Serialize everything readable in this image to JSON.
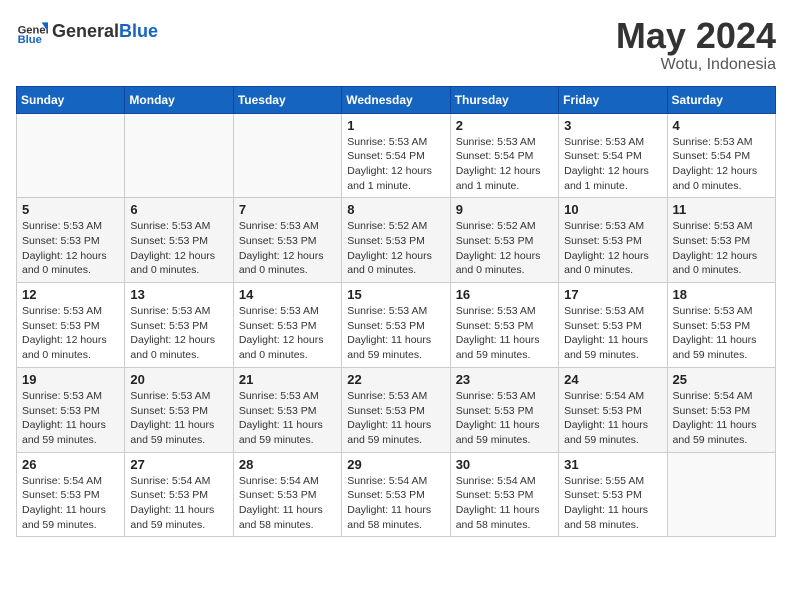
{
  "header": {
    "logo_general": "General",
    "logo_blue": "Blue",
    "month": "May 2024",
    "location": "Wotu, Indonesia"
  },
  "weekdays": [
    "Sunday",
    "Monday",
    "Tuesday",
    "Wednesday",
    "Thursday",
    "Friday",
    "Saturday"
  ],
  "weeks": [
    [
      {
        "day": "",
        "info": ""
      },
      {
        "day": "",
        "info": ""
      },
      {
        "day": "",
        "info": ""
      },
      {
        "day": "1",
        "info": "Sunrise: 5:53 AM\nSunset: 5:54 PM\nDaylight: 12 hours\nand 1 minute."
      },
      {
        "day": "2",
        "info": "Sunrise: 5:53 AM\nSunset: 5:54 PM\nDaylight: 12 hours\nand 1 minute."
      },
      {
        "day": "3",
        "info": "Sunrise: 5:53 AM\nSunset: 5:54 PM\nDaylight: 12 hours\nand 1 minute."
      },
      {
        "day": "4",
        "info": "Sunrise: 5:53 AM\nSunset: 5:54 PM\nDaylight: 12 hours\nand 0 minutes."
      }
    ],
    [
      {
        "day": "5",
        "info": "Sunrise: 5:53 AM\nSunset: 5:53 PM\nDaylight: 12 hours\nand 0 minutes."
      },
      {
        "day": "6",
        "info": "Sunrise: 5:53 AM\nSunset: 5:53 PM\nDaylight: 12 hours\nand 0 minutes."
      },
      {
        "day": "7",
        "info": "Sunrise: 5:53 AM\nSunset: 5:53 PM\nDaylight: 12 hours\nand 0 minutes."
      },
      {
        "day": "8",
        "info": "Sunrise: 5:52 AM\nSunset: 5:53 PM\nDaylight: 12 hours\nand 0 minutes."
      },
      {
        "day": "9",
        "info": "Sunrise: 5:52 AM\nSunset: 5:53 PM\nDaylight: 12 hours\nand 0 minutes."
      },
      {
        "day": "10",
        "info": "Sunrise: 5:53 AM\nSunset: 5:53 PM\nDaylight: 12 hours\nand 0 minutes."
      },
      {
        "day": "11",
        "info": "Sunrise: 5:53 AM\nSunset: 5:53 PM\nDaylight: 12 hours\nand 0 minutes."
      }
    ],
    [
      {
        "day": "12",
        "info": "Sunrise: 5:53 AM\nSunset: 5:53 PM\nDaylight: 12 hours\nand 0 minutes."
      },
      {
        "day": "13",
        "info": "Sunrise: 5:53 AM\nSunset: 5:53 PM\nDaylight: 12 hours\nand 0 minutes."
      },
      {
        "day": "14",
        "info": "Sunrise: 5:53 AM\nSunset: 5:53 PM\nDaylight: 12 hours\nand 0 minutes."
      },
      {
        "day": "15",
        "info": "Sunrise: 5:53 AM\nSunset: 5:53 PM\nDaylight: 11 hours\nand 59 minutes."
      },
      {
        "day": "16",
        "info": "Sunrise: 5:53 AM\nSunset: 5:53 PM\nDaylight: 11 hours\nand 59 minutes."
      },
      {
        "day": "17",
        "info": "Sunrise: 5:53 AM\nSunset: 5:53 PM\nDaylight: 11 hours\nand 59 minutes."
      },
      {
        "day": "18",
        "info": "Sunrise: 5:53 AM\nSunset: 5:53 PM\nDaylight: 11 hours\nand 59 minutes."
      }
    ],
    [
      {
        "day": "19",
        "info": "Sunrise: 5:53 AM\nSunset: 5:53 PM\nDaylight: 11 hours\nand 59 minutes."
      },
      {
        "day": "20",
        "info": "Sunrise: 5:53 AM\nSunset: 5:53 PM\nDaylight: 11 hours\nand 59 minutes."
      },
      {
        "day": "21",
        "info": "Sunrise: 5:53 AM\nSunset: 5:53 PM\nDaylight: 11 hours\nand 59 minutes."
      },
      {
        "day": "22",
        "info": "Sunrise: 5:53 AM\nSunset: 5:53 PM\nDaylight: 11 hours\nand 59 minutes."
      },
      {
        "day": "23",
        "info": "Sunrise: 5:53 AM\nSunset: 5:53 PM\nDaylight: 11 hours\nand 59 minutes."
      },
      {
        "day": "24",
        "info": "Sunrise: 5:54 AM\nSunset: 5:53 PM\nDaylight: 11 hours\nand 59 minutes."
      },
      {
        "day": "25",
        "info": "Sunrise: 5:54 AM\nSunset: 5:53 PM\nDaylight: 11 hours\nand 59 minutes."
      }
    ],
    [
      {
        "day": "26",
        "info": "Sunrise: 5:54 AM\nSunset: 5:53 PM\nDaylight: 11 hours\nand 59 minutes."
      },
      {
        "day": "27",
        "info": "Sunrise: 5:54 AM\nSunset: 5:53 PM\nDaylight: 11 hours\nand 59 minutes."
      },
      {
        "day": "28",
        "info": "Sunrise: 5:54 AM\nSunset: 5:53 PM\nDaylight: 11 hours\nand 58 minutes."
      },
      {
        "day": "29",
        "info": "Sunrise: 5:54 AM\nSunset: 5:53 PM\nDaylight: 11 hours\nand 58 minutes."
      },
      {
        "day": "30",
        "info": "Sunrise: 5:54 AM\nSunset: 5:53 PM\nDaylight: 11 hours\nand 58 minutes."
      },
      {
        "day": "31",
        "info": "Sunrise: 5:55 AM\nSunset: 5:53 PM\nDaylight: 11 hours\nand 58 minutes."
      },
      {
        "day": "",
        "info": ""
      }
    ]
  ]
}
